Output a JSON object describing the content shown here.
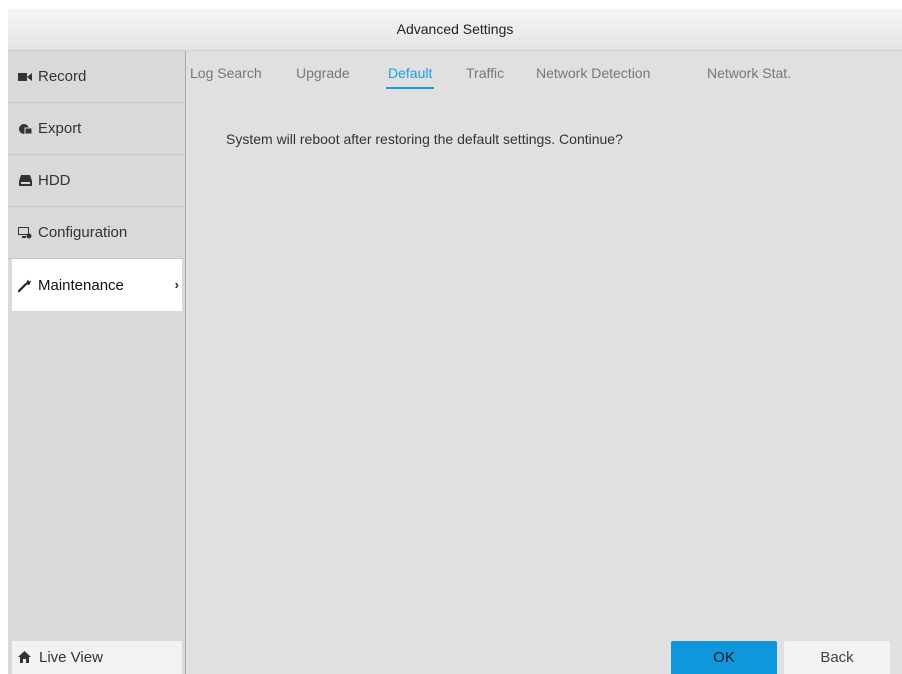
{
  "window": {
    "title": "Advanced Settings"
  },
  "sidebar": {
    "items": [
      {
        "label": "Record",
        "icon": "video-camera-icon"
      },
      {
        "label": "Export",
        "icon": "export-icon"
      },
      {
        "label": "HDD",
        "icon": "hdd-icon"
      },
      {
        "label": "Configuration",
        "icon": "configuration-icon"
      },
      {
        "label": "Maintenance",
        "icon": "wrench-icon",
        "active": true,
        "chevron": "›"
      }
    ],
    "live_view": {
      "label": "Live View",
      "icon": "home-icon"
    }
  },
  "tabs": [
    {
      "label": "Log Search"
    },
    {
      "label": "Upgrade"
    },
    {
      "label": "Default",
      "active": true
    },
    {
      "label": "Traffic"
    },
    {
      "label": "Network Detection"
    },
    {
      "label": "Network Stat."
    }
  ],
  "main": {
    "message": "System will reboot after restoring the default settings. Continue?"
  },
  "buttons": {
    "ok_label": "OK",
    "back_label": "Back"
  },
  "colors": {
    "accent": "#1aa0e0",
    "ok_button": "#0e97db",
    "background": "#e0e0e0"
  }
}
